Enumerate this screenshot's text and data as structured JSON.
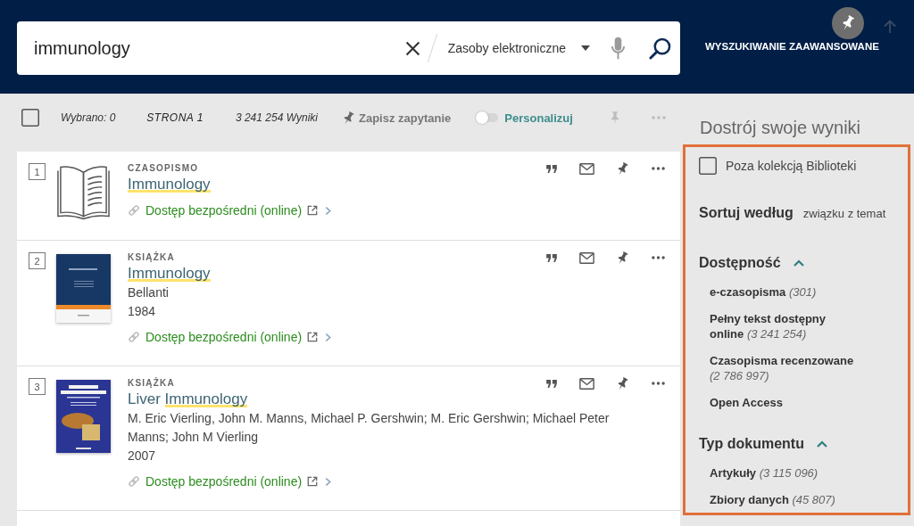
{
  "header": {
    "search": {
      "value": "immunology",
      "scope": "Zasoby elektroniczne"
    },
    "advanced_search": "WYSZUKIWANIE ZAAWANSOWANE"
  },
  "toolbar": {
    "select_all": {
      "checked": false
    },
    "selected_count": "Wybrano: 0",
    "page": "STRONA 1",
    "results_count": "3 241 254 Wyniki",
    "save_query": "Zapisz zapytanie",
    "personalize": {
      "label": "Personalizuj",
      "on": false
    }
  },
  "results": [
    {
      "number": "1",
      "thumbnail": {
        "kind": "outline"
      },
      "type": "CZASOPISMO",
      "title": [
        {
          "text": "Immunology",
          "highlighted": true
        }
      ],
      "access": "Dostęp bezpośredni (online)"
    },
    {
      "number": "2",
      "thumbnail": {
        "kind": "banded"
      },
      "type": "KSIĄŻKA",
      "title": [
        {
          "text": "Immunology",
          "highlighted": true
        }
      ],
      "authors": "Bellanti",
      "year": "1984",
      "access": "Dostęp bezpośredni (online)"
    },
    {
      "number": "3",
      "thumbnail": {
        "kind": "illustrated"
      },
      "type": "KSIĄŻKA",
      "title": [
        {
          "text": "Liver ",
          "highlighted": false
        },
        {
          "text": "Immunology",
          "highlighted": true
        }
      ],
      "authors": "M. Eric Vierling, John M. Manns, Michael P. Gershwin; M. Eric Gershwin; Michael Peter Manns; John M Vierling",
      "year": "2007",
      "access": "Dostęp bezpośredni (online)"
    }
  ],
  "sidebar": {
    "title": "Dostrój swoje wyniki",
    "outside_collection": {
      "label": "Poza kolekcją Biblioteki",
      "checked": false
    },
    "sort": {
      "label": "Sortuj według",
      "value": "związku z temat"
    },
    "facets": [
      {
        "title": "Dostępność",
        "expanded": true,
        "items": [
          {
            "label": "e-czasopisma",
            "count": "(301)"
          },
          {
            "label": "Pełny tekst dostępny online",
            "count": "(3 241 254)"
          },
          {
            "label": "Czasopisma recenzowane",
            "count": "(2 786 997)"
          },
          {
            "label": "Open Access"
          }
        ]
      },
      {
        "title": "Typ dokumentu",
        "expanded": true,
        "items": [
          {
            "label": "Artykuły",
            "count": "(3 115 096)"
          },
          {
            "label": "Zbiory danych",
            "count": "(45 807)"
          }
        ]
      }
    ]
  }
}
